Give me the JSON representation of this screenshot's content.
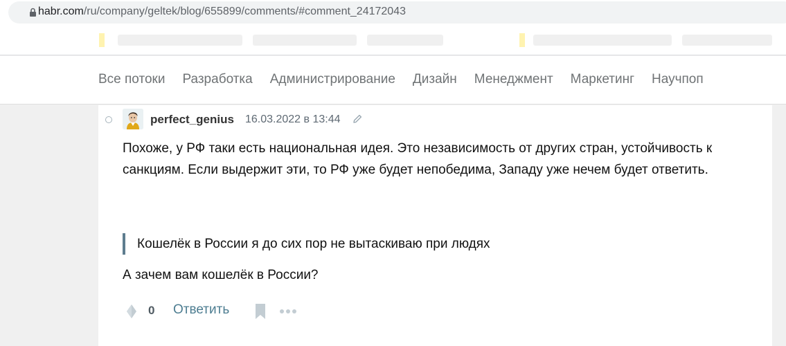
{
  "browser": {
    "url_host": "habr.com",
    "url_path": "/ru/company/geltek/blog/655899/comments/#comment_24172043"
  },
  "nav": {
    "items": [
      "Все потоки",
      "Разработка",
      "Администрирование",
      "Дизайн",
      "Менеджмент",
      "Маркетинг",
      "Научпоп"
    ]
  },
  "comment": {
    "username": "perfect_genius",
    "datetime": "16.03.2022 в 13:44",
    "body": "Похоже, у РФ таки есть национальная идея. Это независимость от других стран, устойчивость к санкциям. Если выдержит эти, то РФ уже будет непобедима, Западу уже нечем будет ответить.",
    "quote": "Кошелёк в России я до сих пор не вытаскиваю при людях",
    "answer": "А зачем вам кошелёк в России?",
    "karma": "0",
    "reply_label": "Ответить"
  },
  "icons": {
    "lock": "lock-icon",
    "avatar": "avatar",
    "edit": "pencil-icon",
    "karma": "vote-diamond-icon",
    "bookmark": "bookmark-icon",
    "more": "more-dots-icon"
  },
  "colors": {
    "nav_text": "#6f7375",
    "link": "#4d7d91",
    "quote_border": "#5e7d8f",
    "icon": "#c3cdd3"
  }
}
